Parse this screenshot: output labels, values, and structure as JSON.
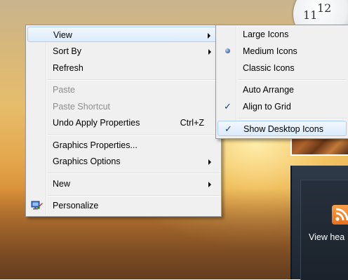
{
  "clock": {
    "numerals": [
      "11",
      "12"
    ]
  },
  "feed": {
    "text": "View hea"
  },
  "context_menu": {
    "items": [
      {
        "label": "View",
        "submenu": true
      },
      {
        "label": "Sort By",
        "submenu": true
      },
      {
        "label": "Refresh"
      },
      {
        "label": "Paste",
        "disabled": true
      },
      {
        "label": "Paste Shortcut",
        "disabled": true
      },
      {
        "label": "Undo Apply Properties",
        "shortcut": "Ctrl+Z"
      },
      {
        "label": "Graphics Properties..."
      },
      {
        "label": "Graphics Options",
        "submenu": true
      },
      {
        "label": "New",
        "submenu": true
      },
      {
        "label": "Personalize"
      }
    ]
  },
  "view_submenu": {
    "items": [
      {
        "label": "Large Icons"
      },
      {
        "label": "Medium Icons",
        "selected": true
      },
      {
        "label": "Classic Icons"
      },
      {
        "label": "Auto Arrange"
      },
      {
        "label": "Align to Grid",
        "checked": true
      },
      {
        "label": "Show Desktop Icons",
        "checked": true
      }
    ]
  },
  "colors": {
    "menu_bg": "#f0f0f0",
    "highlight": "#dcebfc",
    "check": "#1b3b8a",
    "rss": "#e8701a"
  }
}
